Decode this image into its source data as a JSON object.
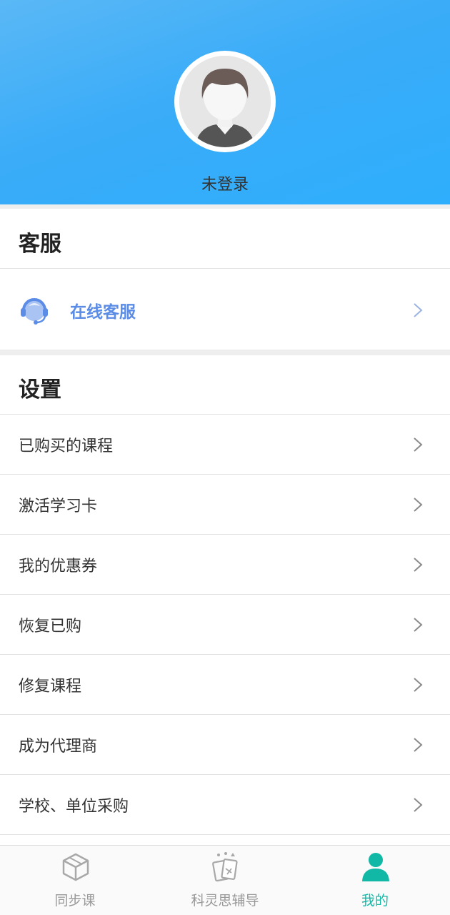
{
  "profile": {
    "login_status": "未登录",
    "avatar_icon": "default-avatar-icon"
  },
  "customer_service": {
    "section_title": "客服",
    "online_service": {
      "label": "在线客服",
      "icon": "headset-icon"
    }
  },
  "settings": {
    "section_title": "设置",
    "items": [
      {
        "label": "已购买的课程"
      },
      {
        "label": "激活学习卡"
      },
      {
        "label": "我的优惠券"
      },
      {
        "label": "恢复已购"
      },
      {
        "label": "修复课程"
      },
      {
        "label": "成为代理商"
      },
      {
        "label": "学校、单位采购"
      }
    ]
  },
  "tabbar": {
    "tabs": [
      {
        "label": "同步课",
        "icon": "cube-icon",
        "active": false
      },
      {
        "label": "科灵思辅导",
        "icon": "study-cards-icon",
        "active": false
      },
      {
        "label": "我的",
        "icon": "person-icon",
        "active": true
      }
    ]
  },
  "colors": {
    "header_blue": "#3aacf8",
    "service_accent": "#5b8ce6",
    "active_tab": "#12b8a6"
  }
}
